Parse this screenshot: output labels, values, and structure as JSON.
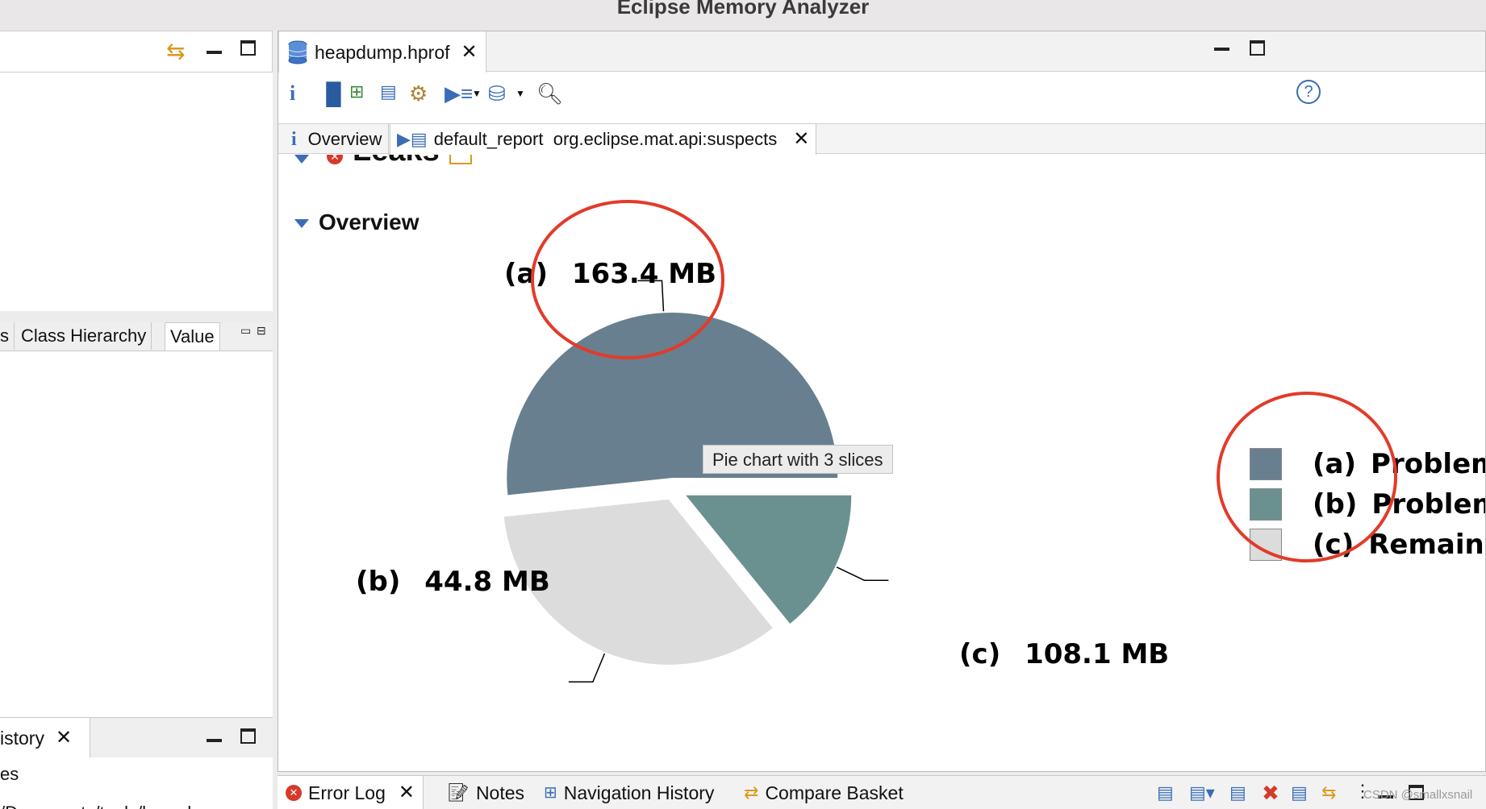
{
  "app": {
    "title": "Eclipse Memory Analyzer"
  },
  "left_panel": {
    "mid_tabs": [
      "s",
      "Class Hierarchy",
      "Value"
    ],
    "bottom_tab": "istory",
    "bottom_line1": "es",
    "bottom_line2": "/Documents/tools/heapdump"
  },
  "editor": {
    "tab_label": "heapdump.hprof",
    "subtabs": {
      "overview": "Overview",
      "report": "default_report  org.eclipse.mat.api:suspects"
    },
    "section_leaks": "Leaks",
    "section_overview": "Overview",
    "tooltip": "Pie chart with 3 slices"
  },
  "chart_data": {
    "type": "pie",
    "slices": [
      {
        "label": "(a)",
        "value": 163.4,
        "value_text": "163.4 MB",
        "legend": "Problem",
        "color": "#687f8f"
      },
      {
        "label": "(b)",
        "value": 44.8,
        "value_text": "44.8 MB",
        "legend": "Problem",
        "color": "#6b9090"
      },
      {
        "label": "(c)",
        "value": 108.1,
        "value_text": "108.1 MB",
        "legend": "Remaind",
        "color": "#dcdcdc"
      }
    ],
    "units": "MB"
  },
  "annotations": {
    "circle_color": "#e23b2a"
  },
  "bottom_bar": {
    "tabs": [
      "Error Log",
      "Notes",
      "Navigation History",
      "Compare Basket"
    ]
  },
  "watermark": "CSDN @smallxsnail"
}
